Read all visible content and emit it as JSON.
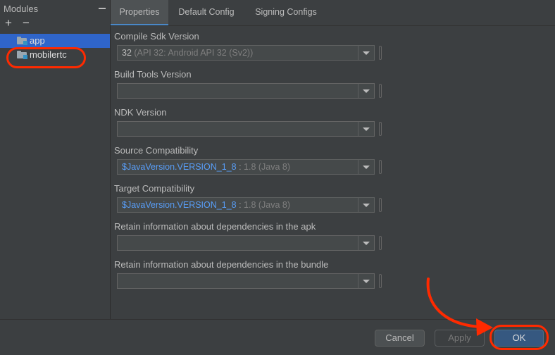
{
  "sidebar": {
    "title": "Modules",
    "add_label": "+",
    "remove_label": "−",
    "items": [
      {
        "label": "app",
        "icon": "module-folder-icon"
      },
      {
        "label": "mobilertc",
        "icon": "module-folder-icon"
      }
    ]
  },
  "tabs": [
    {
      "label": "Properties",
      "active": true
    },
    {
      "label": "Default Config",
      "active": false
    },
    {
      "label": "Signing Configs",
      "active": false
    }
  ],
  "properties": {
    "compile_sdk": {
      "label": "Compile Sdk Version",
      "value": "32",
      "hint": "(API 32: Android API 32 (Sv2))"
    },
    "build_tools": {
      "label": "Build Tools Version",
      "value": ""
    },
    "ndk": {
      "label": "NDK Version",
      "value": ""
    },
    "source_compat": {
      "label": "Source Compatibility",
      "ref": "$JavaVersion.VERSION_1_8",
      "sep": " : ",
      "hint": "1.8 (Java 8)"
    },
    "target_compat": {
      "label": "Target Compatibility",
      "ref": "$JavaVersion.VERSION_1_8",
      "sep": " : ",
      "hint": "1.8 (Java 8)"
    },
    "deps_apk": {
      "label": "Retain information about dependencies in the apk",
      "value": ""
    },
    "deps_bundle": {
      "label": "Retain information about dependencies in the bundle",
      "value": ""
    }
  },
  "buttons": {
    "cancel": "Cancel",
    "apply": "Apply",
    "ok": "OK"
  },
  "colors": {
    "background": "#3c3f41",
    "selection": "#2f65ca",
    "link": "#589df6",
    "ok_button": "#365880",
    "annotation": "#ff2a00"
  }
}
